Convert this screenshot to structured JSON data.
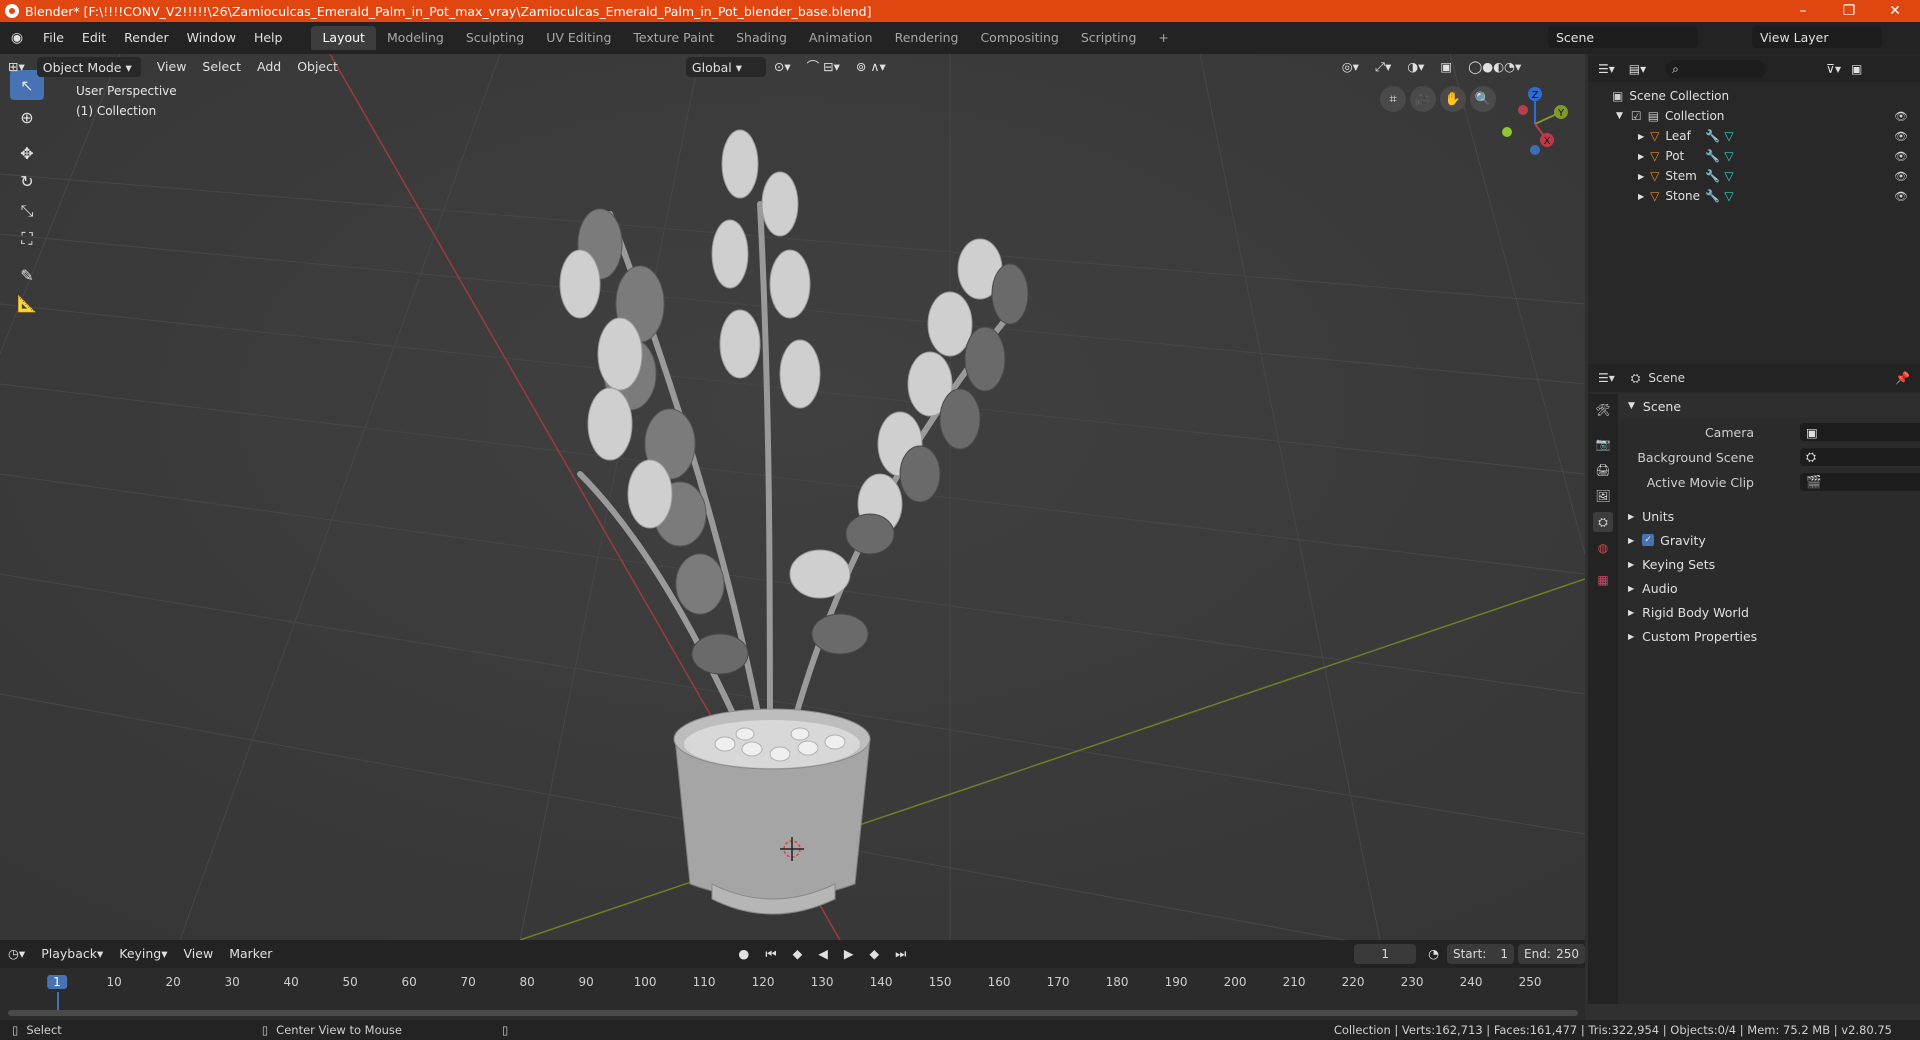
{
  "window": {
    "title": "Blender* [F:\\!!!!CONV_V2!!!!!\\26\\Zamioculcas_Emerald_Palm_in_Pot_max_vray\\Zamioculcas_Emerald_Palm_in_Pot_blender_base.blend]",
    "minimize": "–",
    "restore": "❐",
    "close": "✕"
  },
  "menubar": {
    "menus": [
      "File",
      "Edit",
      "Render",
      "Window",
      "Help"
    ],
    "workspaces": [
      "Layout",
      "Modeling",
      "Sculpting",
      "UV Editing",
      "Texture Paint",
      "Shading",
      "Animation",
      "Rendering",
      "Compositing",
      "Scripting"
    ],
    "add_workspace": "+",
    "scene_name": "Scene",
    "view_layer": "View Layer"
  },
  "viewport": {
    "mode": "Object Mode",
    "menus": [
      "View",
      "Select",
      "Add",
      "Object"
    ],
    "orientation": "Global",
    "perspective_label": "User Perspective",
    "collection_label": "(1) Collection",
    "gizmo": {
      "z": "Z",
      "y": "Y",
      "x": "X"
    }
  },
  "outliner": {
    "root": "Scene Collection",
    "collection": "Collection",
    "objects": [
      "Leaf",
      "Pot",
      "Stem",
      "Stone"
    ],
    "search_placeholder": ""
  },
  "properties": {
    "context": "Scene",
    "panel": "Scene",
    "camera_label": "Camera",
    "background_scene_label": "Background Scene",
    "active_movie_clip_label": "Active Movie Clip",
    "sections": [
      "Units",
      "Gravity",
      "Keying Sets",
      "Audio",
      "Rigid Body World",
      "Custom Properties"
    ],
    "gravity_checked": true
  },
  "timeline": {
    "menus": [
      "Playback",
      "Keying",
      "View",
      "Marker"
    ],
    "current_frame": "1",
    "start_label": "Start:",
    "start": "1",
    "end_label": "End:",
    "end": "250",
    "ticks": [
      "1",
      "10",
      "20",
      "30",
      "40",
      "50",
      "60",
      "70",
      "80",
      "90",
      "100",
      "110",
      "120",
      "130",
      "140",
      "150",
      "160",
      "170",
      "180",
      "190",
      "200",
      "210",
      "220",
      "230",
      "240",
      "250"
    ]
  },
  "statusbar": {
    "left_action": "Select",
    "middle_action": "Center View to Mouse",
    "stats": "Collection | Verts:162,713 | Faces:161,477 | Tris:322,954 | Objects:0/4 | Mem: 75.2 MB | v2.80.75"
  },
  "colors": {
    "accent": "#4772b3",
    "title_bar": "#e0460f",
    "x_axis": "#c0394a",
    "y_axis": "#7d9a2a",
    "z_axis": "#2f6dd6"
  }
}
